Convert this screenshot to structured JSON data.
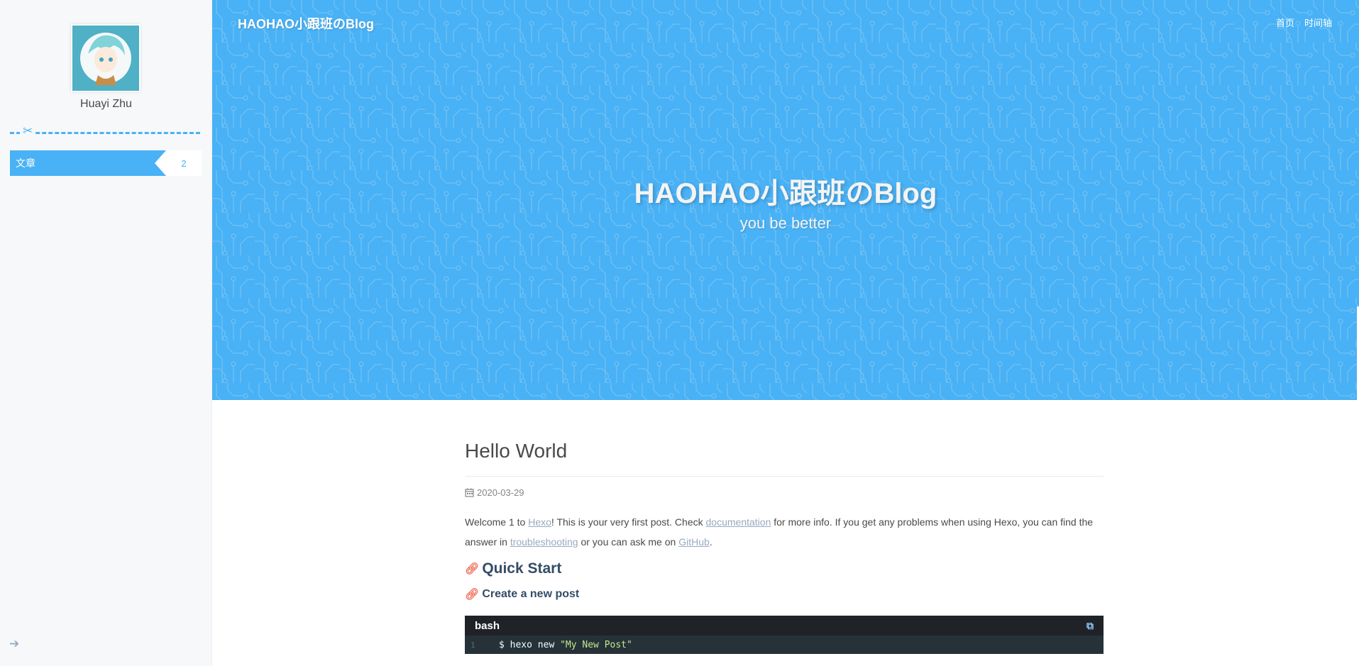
{
  "sidebar": {
    "author_name": "Huayi Zhu",
    "menu": [
      {
        "label": "文章",
        "count": "2"
      }
    ],
    "scissors_icon": "scissors-icon",
    "toggle_icon": "arrow-left-icon"
  },
  "header": {
    "brand": "HAOHAO小跟班のBlog",
    "nav": [
      {
        "label": "首页"
      },
      {
        "label": "时间轴"
      }
    ],
    "site_title": "HAOHAO小跟班のBlog",
    "site_subtitle": "you be better",
    "background_color": "#49b1f5"
  },
  "post": {
    "title": "Hello World",
    "date": "2020-03-29",
    "intro": {
      "t1": "Welcome 1 to ",
      "link1": "Hexo",
      "t2": "! This is your very first post. Check ",
      "link2": "documentation",
      "t3": " for more info. If you get any problems when using Hexo, you can find the answer in ",
      "link3": "troubleshooting",
      "t4": " or you can ask me on ",
      "link4": "GitHub",
      "t5": "."
    },
    "h2": "Quick Start",
    "h3": "Create a new post",
    "code": {
      "lang": "bash",
      "line_no": "1",
      "cmd": "$ hexo new ",
      "arg": "\"My New Post\""
    }
  },
  "colors": {
    "accent": "#49b1f5",
    "heading": "#344c67",
    "link": "#99a9bf",
    "anchor_icon": "#ef6f5b",
    "code_bg": "#263238"
  }
}
